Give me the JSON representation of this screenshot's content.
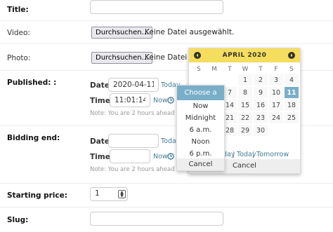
{
  "fields": {
    "title": {
      "label": "Title:"
    },
    "video": {
      "label": "Video:",
      "button": "Durchsuchen...",
      "status": "Keine Datei ausgewählt."
    },
    "photo": {
      "label": "Photo:",
      "button": "Durchsuchen...",
      "status": "Keine Datei ausgewählt."
    },
    "published": {
      "label": "Published: :",
      "date_label": "Date:",
      "date_value": "2020-04-11",
      "today_link": "Today",
      "time_label": "Time:",
      "time_value": "11:01:14",
      "now_link": "Now",
      "note": "Note: You are 2 hours ahead of server time."
    },
    "bidding_end": {
      "label": "Bidding end:",
      "date_label": "Date:",
      "date_value": "",
      "today_link": "Today",
      "time_label": "Time:",
      "time_value": "",
      "now_link": "Now",
      "note": "Note: You are 2 hours ahead of server time."
    },
    "starting_price": {
      "label": "Starting price:",
      "value": "1"
    },
    "slug": {
      "label": "Slug:"
    }
  },
  "time_popup": {
    "title": "Choose a time",
    "options": [
      "Now",
      "Midnight",
      "6 a.m.",
      "Noon",
      "6 p.m."
    ],
    "cancel": "Cancel"
  },
  "calendar": {
    "month_label": "APRIL 2020",
    "weekdays": [
      "S",
      "M",
      "T",
      "W",
      "T",
      "F",
      "S"
    ],
    "days": [
      "1",
      "2",
      "3",
      "4",
      "5",
      "6",
      "7",
      "8",
      "9",
      "10",
      "11",
      "12",
      "13",
      "14",
      "15",
      "16",
      "17",
      "18",
      "19",
      "20",
      "21",
      "22",
      "23",
      "24",
      "25",
      "26",
      "27",
      "28",
      "29",
      "30"
    ],
    "selected_day": "11",
    "footer": {
      "yesterday_fragment": "day",
      "separator": "|",
      "today": "Today",
      "tomorrow": "Tomorrow"
    },
    "cancel": "Cancel"
  },
  "colors": {
    "accent": "#79aec8",
    "calendar_header": "#f5dd5d",
    "link": "#447e9b"
  }
}
